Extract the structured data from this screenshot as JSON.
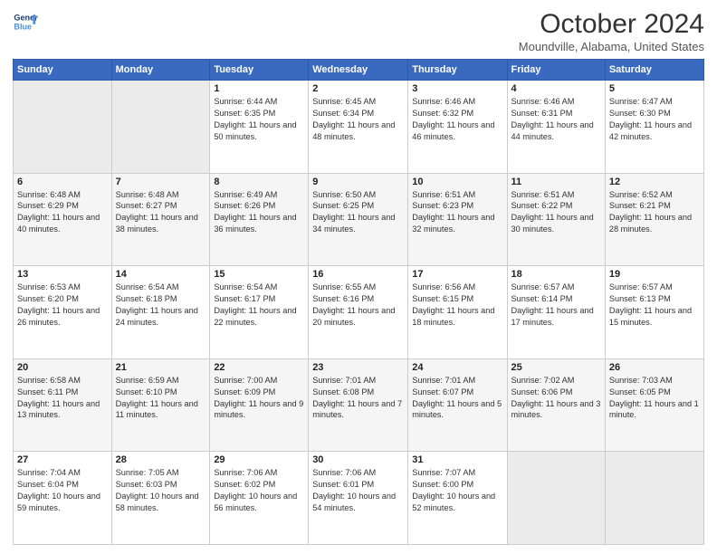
{
  "header": {
    "logo_line1": "General",
    "logo_line2": "Blue",
    "month": "October 2024",
    "location": "Moundville, Alabama, United States"
  },
  "days_of_week": [
    "Sunday",
    "Monday",
    "Tuesday",
    "Wednesday",
    "Thursday",
    "Friday",
    "Saturday"
  ],
  "weeks": [
    [
      {
        "day": "",
        "empty": true
      },
      {
        "day": "",
        "empty": true
      },
      {
        "day": "1",
        "sunrise": "6:44 AM",
        "sunset": "6:35 PM",
        "daylight": "11 hours and 50 minutes."
      },
      {
        "day": "2",
        "sunrise": "6:45 AM",
        "sunset": "6:34 PM",
        "daylight": "11 hours and 48 minutes."
      },
      {
        "day": "3",
        "sunrise": "6:46 AM",
        "sunset": "6:32 PM",
        "daylight": "11 hours and 46 minutes."
      },
      {
        "day": "4",
        "sunrise": "6:46 AM",
        "sunset": "6:31 PM",
        "daylight": "11 hours and 44 minutes."
      },
      {
        "day": "5",
        "sunrise": "6:47 AM",
        "sunset": "6:30 PM",
        "daylight": "11 hours and 42 minutes."
      }
    ],
    [
      {
        "day": "6",
        "sunrise": "6:48 AM",
        "sunset": "6:29 PM",
        "daylight": "11 hours and 40 minutes."
      },
      {
        "day": "7",
        "sunrise": "6:48 AM",
        "sunset": "6:27 PM",
        "daylight": "11 hours and 38 minutes."
      },
      {
        "day": "8",
        "sunrise": "6:49 AM",
        "sunset": "6:26 PM",
        "daylight": "11 hours and 36 minutes."
      },
      {
        "day": "9",
        "sunrise": "6:50 AM",
        "sunset": "6:25 PM",
        "daylight": "11 hours and 34 minutes."
      },
      {
        "day": "10",
        "sunrise": "6:51 AM",
        "sunset": "6:23 PM",
        "daylight": "11 hours and 32 minutes."
      },
      {
        "day": "11",
        "sunrise": "6:51 AM",
        "sunset": "6:22 PM",
        "daylight": "11 hours and 30 minutes."
      },
      {
        "day": "12",
        "sunrise": "6:52 AM",
        "sunset": "6:21 PM",
        "daylight": "11 hours and 28 minutes."
      }
    ],
    [
      {
        "day": "13",
        "sunrise": "6:53 AM",
        "sunset": "6:20 PM",
        "daylight": "11 hours and 26 minutes."
      },
      {
        "day": "14",
        "sunrise": "6:54 AM",
        "sunset": "6:18 PM",
        "daylight": "11 hours and 24 minutes."
      },
      {
        "day": "15",
        "sunrise": "6:54 AM",
        "sunset": "6:17 PM",
        "daylight": "11 hours and 22 minutes."
      },
      {
        "day": "16",
        "sunrise": "6:55 AM",
        "sunset": "6:16 PM",
        "daylight": "11 hours and 20 minutes."
      },
      {
        "day": "17",
        "sunrise": "6:56 AM",
        "sunset": "6:15 PM",
        "daylight": "11 hours and 18 minutes."
      },
      {
        "day": "18",
        "sunrise": "6:57 AM",
        "sunset": "6:14 PM",
        "daylight": "11 hours and 17 minutes."
      },
      {
        "day": "19",
        "sunrise": "6:57 AM",
        "sunset": "6:13 PM",
        "daylight": "11 hours and 15 minutes."
      }
    ],
    [
      {
        "day": "20",
        "sunrise": "6:58 AM",
        "sunset": "6:11 PM",
        "daylight": "11 hours and 13 minutes."
      },
      {
        "day": "21",
        "sunrise": "6:59 AM",
        "sunset": "6:10 PM",
        "daylight": "11 hours and 11 minutes."
      },
      {
        "day": "22",
        "sunrise": "7:00 AM",
        "sunset": "6:09 PM",
        "daylight": "11 hours and 9 minutes."
      },
      {
        "day": "23",
        "sunrise": "7:01 AM",
        "sunset": "6:08 PM",
        "daylight": "11 hours and 7 minutes."
      },
      {
        "day": "24",
        "sunrise": "7:01 AM",
        "sunset": "6:07 PM",
        "daylight": "11 hours and 5 minutes."
      },
      {
        "day": "25",
        "sunrise": "7:02 AM",
        "sunset": "6:06 PM",
        "daylight": "11 hours and 3 minutes."
      },
      {
        "day": "26",
        "sunrise": "7:03 AM",
        "sunset": "6:05 PM",
        "daylight": "11 hours and 1 minute."
      }
    ],
    [
      {
        "day": "27",
        "sunrise": "7:04 AM",
        "sunset": "6:04 PM",
        "daylight": "10 hours and 59 minutes."
      },
      {
        "day": "28",
        "sunrise": "7:05 AM",
        "sunset": "6:03 PM",
        "daylight": "10 hours and 58 minutes."
      },
      {
        "day": "29",
        "sunrise": "7:06 AM",
        "sunset": "6:02 PM",
        "daylight": "10 hours and 56 minutes."
      },
      {
        "day": "30",
        "sunrise": "7:06 AM",
        "sunset": "6:01 PM",
        "daylight": "10 hours and 54 minutes."
      },
      {
        "day": "31",
        "sunrise": "7:07 AM",
        "sunset": "6:00 PM",
        "daylight": "10 hours and 52 minutes."
      },
      {
        "day": "",
        "empty": true
      },
      {
        "day": "",
        "empty": true
      }
    ]
  ]
}
